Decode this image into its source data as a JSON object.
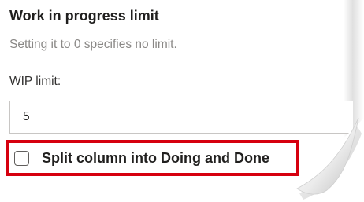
{
  "section": {
    "title": "Work in progress limit",
    "hint": "Setting it to 0 specifies no limit."
  },
  "wip": {
    "label": "WIP limit:",
    "value": "5"
  },
  "split": {
    "label": "Split column into Doing and Done",
    "checked": false
  },
  "colors": {
    "highlight": "#d6000f",
    "text": "#201f1e",
    "muted": "#8a8886"
  }
}
